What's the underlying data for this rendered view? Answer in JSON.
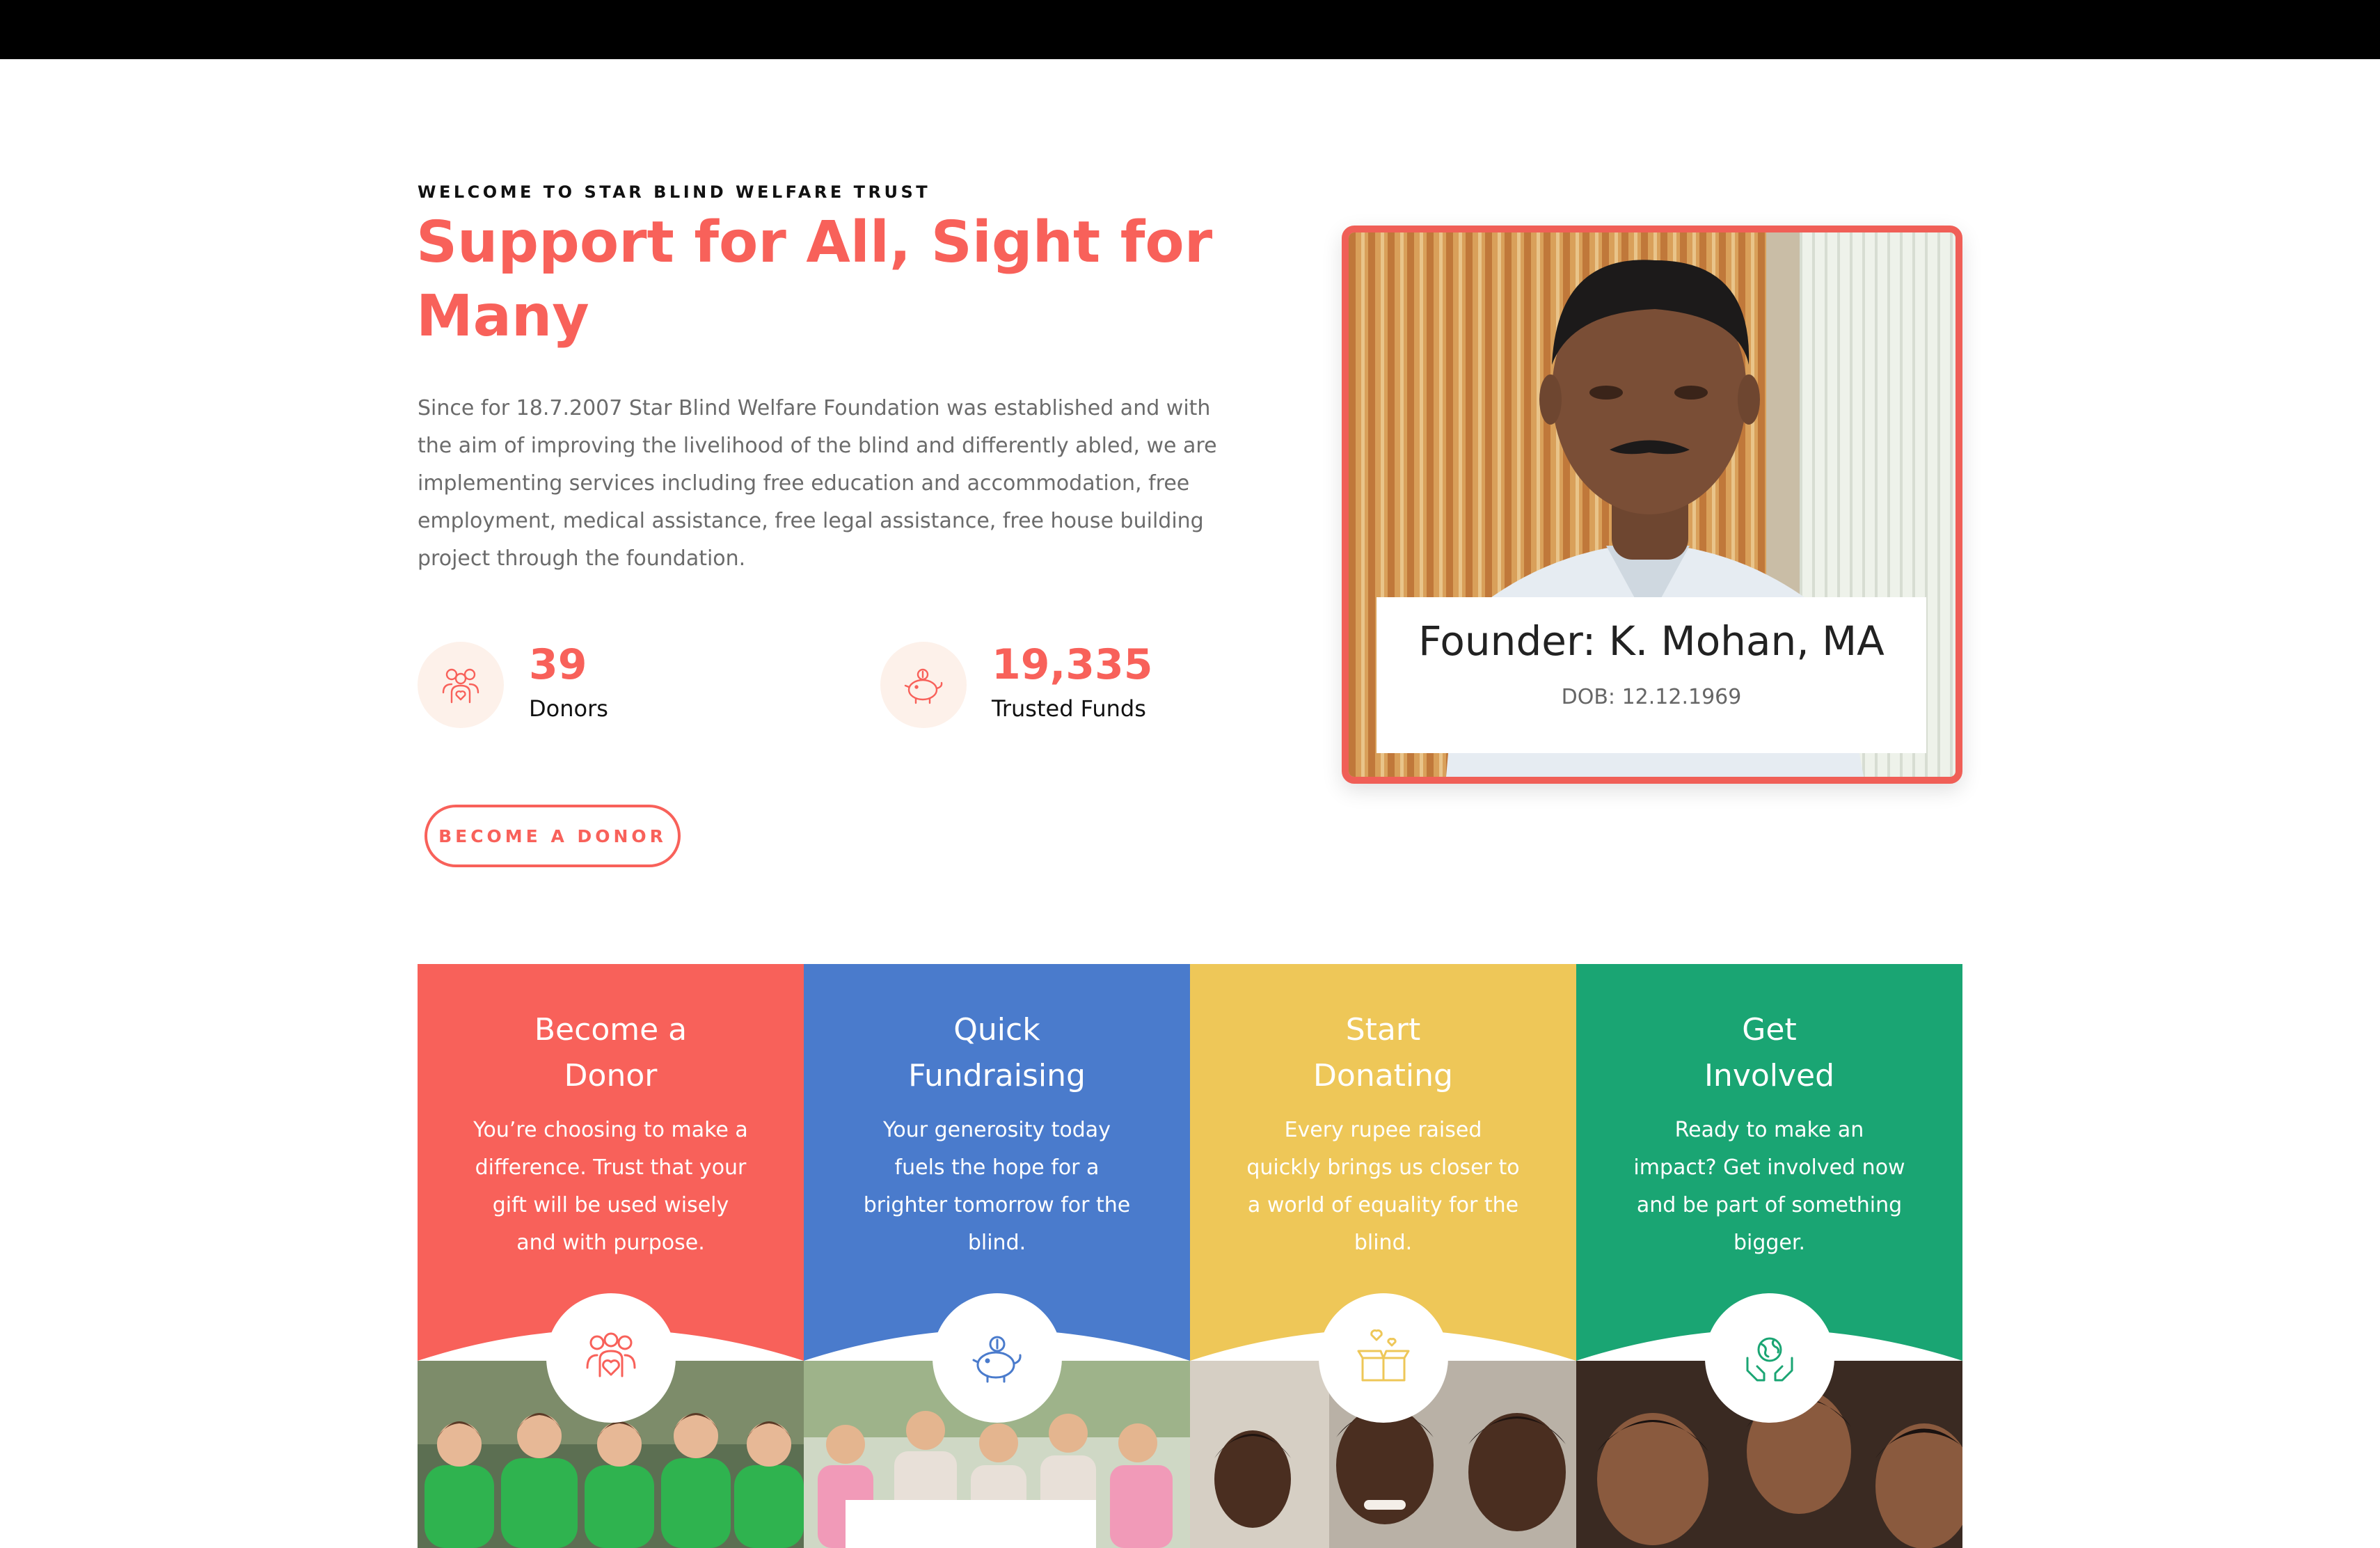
{
  "hero": {
    "eyebrow": "WELCOME TO STAR BLIND WELFARE TRUST",
    "title": "Support for All, Sight for Many",
    "description": "Since for 18.7.2007 Star Blind Welfare Foundation was established and with the aim of improving the livelihood of the blind and differently abled, we are implementing services including free education and accommodation, free employment, medical assistance, free legal assistance, free house building project through the foundation.",
    "accent_color": "#f8615a"
  },
  "stats": [
    {
      "value": "39",
      "label": "Donors",
      "icon": "donors-group-icon"
    },
    {
      "value": "19,335",
      "label": "Trusted Funds",
      "icon": "piggy-bank-icon"
    }
  ],
  "cta": {
    "label": "BECOME A DONOR"
  },
  "founder": {
    "name": "Founder: K. Mohan, MA",
    "dob": "DOB: 12.12.1969"
  },
  "cards": [
    {
      "title_line1": "Become a",
      "title_line2": "Donor",
      "desc": "You’re choosing to make a difference. Trust that your gift will be used wisely and with purpose.",
      "color": "#f8615a",
      "icon": "volunteers-heart-icon"
    },
    {
      "title_line1": "Quick",
      "title_line2": "Fundraising",
      "desc": "Your generosity today fuels the hope for a brighter tomorrow for the blind.",
      "color": "#4a7bcc",
      "icon": "piggy-bank-icon"
    },
    {
      "title_line1": "Start",
      "title_line2": "Donating",
      "desc": "Every rupee raised quickly brings us closer to a world of equality for the blind.",
      "color": "#eec758",
      "icon": "donation-box-icon"
    },
    {
      "title_line1": "Get",
      "title_line2": "Involved",
      "desc": "Ready to make an impact? Get involved now and be part of something bigger.",
      "color": "#1aa573",
      "icon": "globe-hands-icon"
    }
  ]
}
